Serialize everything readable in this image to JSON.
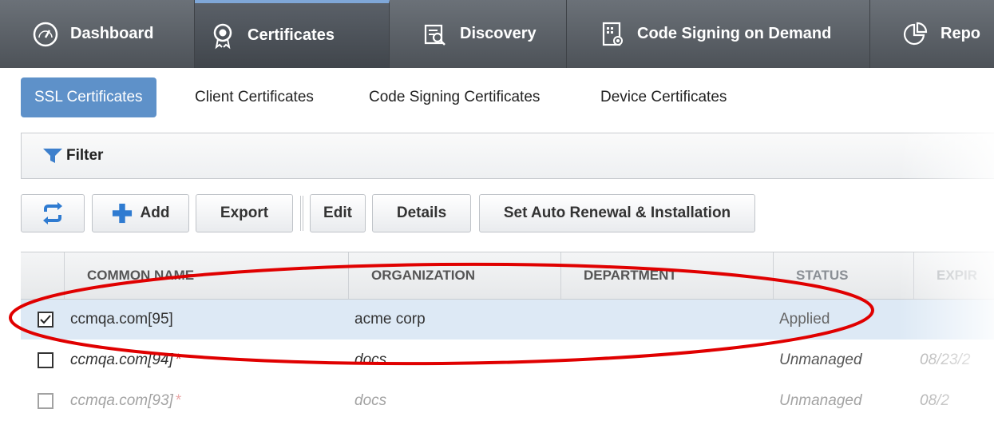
{
  "nav": {
    "tabs": [
      {
        "label": "Dashboard",
        "icon": "gauge-icon"
      },
      {
        "label": "Certificates",
        "icon": "certificate-badge-icon",
        "active": true
      },
      {
        "label": "Discovery",
        "icon": "discovery-icon"
      },
      {
        "label": "Code Signing on Demand",
        "icon": "code-signing-icon"
      },
      {
        "label": "Repo",
        "icon": "reports-icon"
      }
    ]
  },
  "subtabs": [
    {
      "label": "SSL Certificates",
      "active": true
    },
    {
      "label": "Client Certificates"
    },
    {
      "label": "Code Signing Certificates"
    },
    {
      "label": "Device Certificates"
    }
  ],
  "filter": {
    "label": "Filter",
    "icon": "funnel-icon"
  },
  "toolbar": {
    "refresh_icon": "refresh-icon",
    "add_label": "Add",
    "export_label": "Export",
    "edit_label": "Edit",
    "details_label": "Details",
    "auto_renew_label": "Set Auto Renewal & Installation"
  },
  "table": {
    "headers": [
      "COMMON NAME",
      "ORGANIZATION",
      "DEPARTMENT",
      "STATUS",
      "EXPIR"
    ],
    "rows": [
      {
        "checked": true,
        "common_name": "ccmqa.com[95]",
        "asterisk": "",
        "organization": "acme corp",
        "department": "",
        "status": "Applied",
        "expires": ""
      },
      {
        "checked": false,
        "common_name": "ccmqa.com[94]",
        "asterisk": "*",
        "organization": "docs",
        "department": "",
        "status": "Unmanaged",
        "expires": "08/23/2"
      },
      {
        "checked": false,
        "common_name": "ccmqa.com[93]",
        "asterisk": "*",
        "organization": "docs",
        "department": "",
        "status": "Unmanaged",
        "expires": "08/2"
      }
    ]
  },
  "colors": {
    "accent": "#5e91c9",
    "nav_bg": "#5a6066",
    "annotation": "#e00000"
  }
}
